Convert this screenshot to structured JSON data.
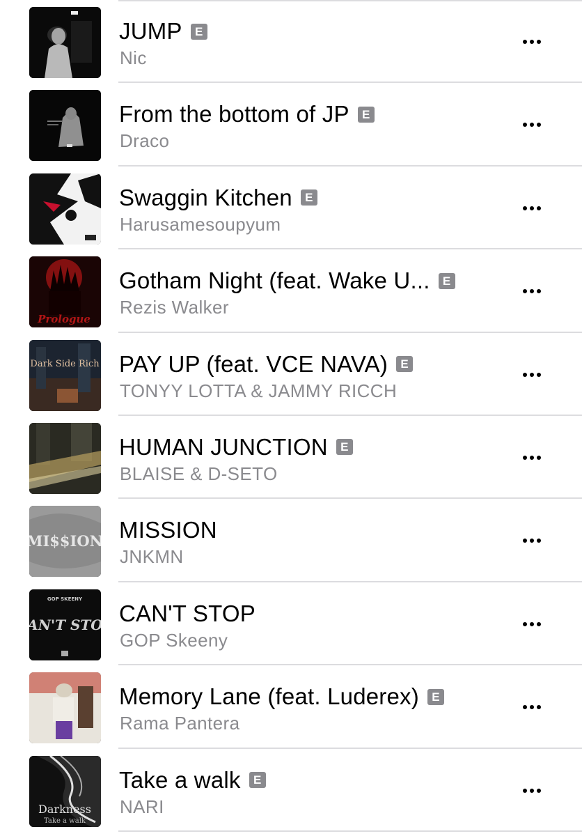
{
  "tracks": [
    {
      "title": "JUMP",
      "artist": "Nic",
      "explicit": true,
      "explicit_label": "E",
      "artwork_icon": "album-artwork-jump",
      "artwork_colors": [
        "#0a0a0a",
        "#d8d8d8"
      ]
    },
    {
      "title": "From the bottom of JP",
      "artist": "Draco",
      "explicit": true,
      "explicit_label": "E",
      "artwork_icon": "album-artwork-from-the-bottom",
      "artwork_colors": [
        "#070707",
        "#bfbfbf"
      ]
    },
    {
      "title": "Swaggin Kitchen",
      "artist": "Harusamesoupyum",
      "explicit": true,
      "explicit_label": "E",
      "artwork_icon": "album-artwork-swaggin-kitchen",
      "artwork_colors": [
        "#f2f2f2",
        "#111111",
        "#c8102e"
      ]
    },
    {
      "title": "Gotham Night (feat. Wake U...",
      "artist": "Rezis Walker",
      "explicit": true,
      "explicit_label": "E",
      "artwork_icon": "album-artwork-prologue",
      "artwork_colors": [
        "#1a0505",
        "#b01515",
        "#e8c0a0"
      ]
    },
    {
      "title": "PAY UP (feat. VCE NAVA)",
      "artist": "TONYY LOTTA & JAMMY RICCH",
      "explicit": true,
      "explicit_label": "E",
      "artwork_icon": "album-artwork-dark-side-rich",
      "artwork_colors": [
        "#1c2430",
        "#a0603a",
        "#e0c0a0"
      ]
    },
    {
      "title": "HUMAN JUNCTION",
      "artist": "BLAISE & D-SETO",
      "explicit": true,
      "explicit_label": "E",
      "artwork_icon": "album-artwork-human-junction",
      "artwork_colors": [
        "#2a2a22",
        "#b8a060",
        "#dcd0a0"
      ]
    },
    {
      "title": "MISSION",
      "artist": "JNKMN",
      "explicit": false,
      "explicit_label": "",
      "artwork_icon": "album-artwork-mission",
      "artwork_colors": [
        "#9a9a9a",
        "#e6e6e6"
      ]
    },
    {
      "title": "CAN'T STOP",
      "artist": "GOP Skeeny",
      "explicit": false,
      "explicit_label": "",
      "artwork_icon": "album-artwork-cant-stop",
      "artwork_colors": [
        "#0c0c0c",
        "#d0d0d0"
      ]
    },
    {
      "title": "Memory Lane (feat. Luderex)",
      "artist": "Rama Pantera",
      "explicit": true,
      "explicit_label": "E",
      "artwork_icon": "album-artwork-memory-lane",
      "artwork_colors": [
        "#c04030",
        "#e8e4dc",
        "#6a3ea0"
      ]
    },
    {
      "title": "Take a walk",
      "artist": "NARI",
      "explicit": true,
      "explicit_label": "E",
      "artwork_icon": "album-artwork-take-a-walk",
      "artwork_colors": [
        "#101010",
        "#e0e0e0"
      ]
    }
  ],
  "artwork_text": {
    "dark_side": "Dark Side Rich",
    "prologue": "Prologue",
    "mission": "MI$$ION",
    "cant_stop_top": "GOP SKEENY",
    "cant_stop": "CAN'T STOP",
    "darkness": "Darkness",
    "take_a_walk": "Take a walk"
  },
  "more_icon": "ellipsis-more-icon"
}
